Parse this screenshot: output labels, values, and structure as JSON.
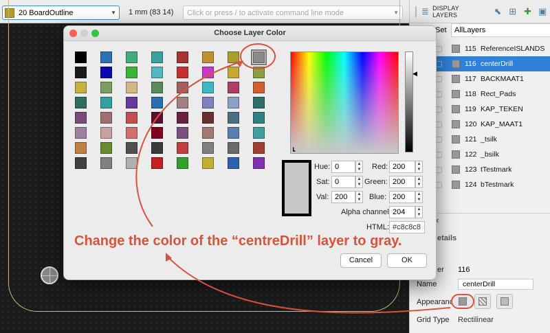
{
  "toolbar": {
    "layer_select": "20 BoardOutline",
    "grid_info": "1 mm (83 14)",
    "command_placeholder": "Click or press / to activate command line mode"
  },
  "panel": {
    "tab_label": "DISPLAY LAYERS",
    "set_label": "Set",
    "set_value": "AllLayers",
    "layers": [
      {
        "num": "115",
        "name": "ReferenceISLANDS",
        "selected": false
      },
      {
        "num": "116",
        "name": "centerDrill",
        "selected": true
      },
      {
        "num": "117",
        "name": "BACKMAAT1",
        "selected": false
      },
      {
        "num": "118",
        "name": "Rect_Pads",
        "selected": false
      },
      {
        "num": "119",
        "name": "KAP_TEKEN",
        "selected": false
      },
      {
        "num": "120",
        "name": "KAP_MAAT1",
        "selected": false
      },
      {
        "num": "121",
        "name": "_tsilk",
        "selected": false
      },
      {
        "num": "122",
        "name": "_bsilk",
        "selected": false
      },
      {
        "num": "123",
        "name": "tTestmark",
        "selected": false
      },
      {
        "num": "124",
        "name": "bTestmark",
        "selected": false
      }
    ],
    "details_header": "etails",
    "detail_number_label": "er",
    "detail_number": "116",
    "name_label": "Name",
    "name_value": "centerDrill",
    "appearance_label": "Appearance",
    "grid_type_label": "Grid Type",
    "grid_type_value": "Rectilinear"
  },
  "dialog": {
    "title": "Choose Layer Color",
    "swatches": [
      "#000000",
      "#2f6fb3",
      "#3fae7a",
      "#3e9f9f",
      "#a93232",
      "#c09133",
      "#a8a02d",
      "#8a8a8a",
      "#1a1a1a",
      "#0a0ab0",
      "#3bb43b",
      "#52b8bd",
      "#c83030",
      "#c838c8",
      "#c8a830",
      "#8aa040",
      "#c8b040",
      "#7aa060",
      "#d0b888",
      "#5a8a5a",
      "#a06060",
      "#40b8c0",
      "#b04060",
      "#d06030",
      "#2e6e5e",
      "#30a0a0",
      "#6a3a9a",
      "#2a70b0",
      "#a08080",
      "#8080c0",
      "#8aa0c8",
      "#2e6f6a",
      "#7a4a7a",
      "#a07070",
      "#c05050",
      "#5a1030",
      "#6a2040",
      "#6a3030",
      "#4a6f80",
      "#308080",
      "#a080a0",
      "#c8a0a0",
      "#d07070",
      "#800020",
      "#7a5080",
      "#a07a70",
      "#5a80b0",
      "#40a0a0",
      "#c08040",
      "#6a8a30",
      "#505050",
      "#3a3a3a",
      "#c04040",
      "#808080",
      "#6a6a6a",
      "#a04030",
      "#404040",
      "#808080",
      "#b0b0b0",
      "#c02020",
      "#30a030",
      "#c0b030",
      "#3060b0",
      "#8030b0"
    ],
    "hue_label": "Hue:",
    "hue": "0",
    "sat_label": "Sat:",
    "sat": "0",
    "val_label": "Val:",
    "val": "200",
    "red_label": "Red:",
    "red": "200",
    "green_label": "Green:",
    "green": "200",
    "blue_label": "Blue:",
    "blue": "200",
    "alpha_label": "Alpha channel:",
    "alpha": "204",
    "html_label": "HTML:",
    "html": "#c8c8c8",
    "cancel": "Cancel",
    "ok": "OK"
  },
  "annotation": {
    "text": "Change the color of the “centreDrill” layer to gray.",
    "color": "#d9533b"
  }
}
